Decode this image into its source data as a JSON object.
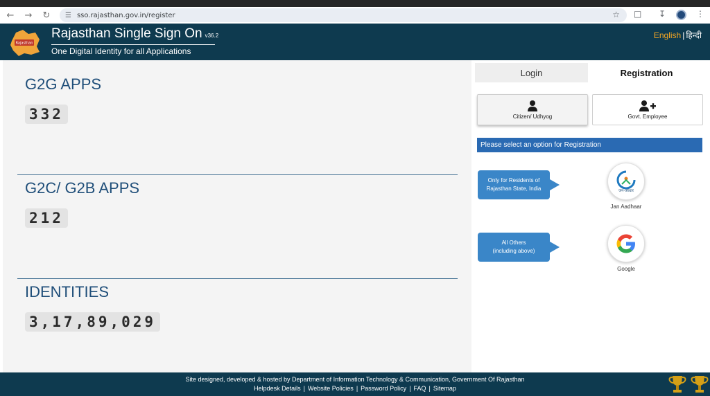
{
  "browser": {
    "url": "sso.rajasthan.gov.in/register"
  },
  "header": {
    "title": "Rajasthan Single Sign On",
    "version": "v36.2",
    "tagline": "One Digital Identity for all Applications",
    "lang_english": "English",
    "lang_separator": "|",
    "lang_hindi": "हिन्दी"
  },
  "stats": {
    "g2g_title": "G2G APPS",
    "g2g_value": "332",
    "g2c_title": "G2C/ G2B APPS",
    "g2c_value": "212",
    "identities_title": "IDENTITIES",
    "identities_value": "3,17,89,029"
  },
  "tabs": {
    "login": "Login",
    "registration": "Registration"
  },
  "options": {
    "citizen": "Citizen/ Udhyog",
    "govt": "Govt. Employee"
  },
  "info_bar": "Please select an option for Registration",
  "callouts": {
    "residents_line1": "Only for Residents of",
    "residents_line2": "Rajasthan State, India",
    "others_line1": "All Others",
    "others_line2": "(including above)"
  },
  "providers": {
    "jan_aadhaar": "Jan Aadhaar",
    "jan_aadhaar_logo_text": "जन-आधार",
    "google": "Google"
  },
  "footer": {
    "line1": "Site designed, developed & hosted by Department of Information Technology & Communication, Government Of Rajasthan",
    "links": [
      "Helpdesk Details",
      "Website Policies",
      "Password Policy",
      "FAQ",
      "Sitemap"
    ]
  },
  "colors": {
    "header_bg": "#0e3a4f",
    "accent_blue": "#2a6ab3",
    "stat_title": "#1f4e79",
    "lang_active": "#f5a623"
  },
  "icons": [
    "back-arrow-icon",
    "forward-arrow-icon",
    "reload-icon",
    "site-info-icon",
    "star-icon",
    "extensions-icon",
    "download-icon",
    "menu-icon",
    "user-icon",
    "user-plus-icon",
    "jan-aadhaar-icon",
    "google-icon",
    "trophy-icon"
  ]
}
